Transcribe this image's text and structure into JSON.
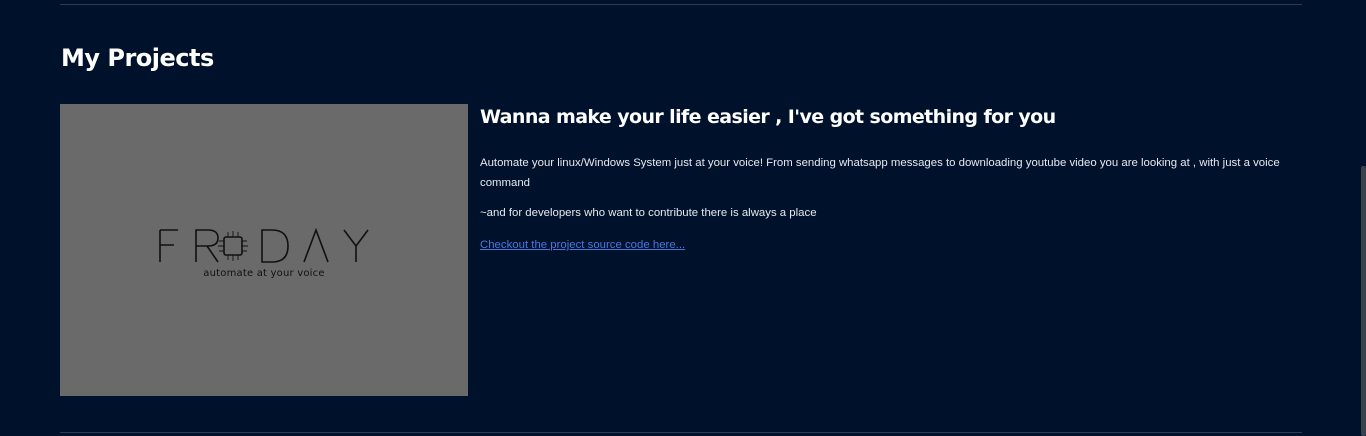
{
  "section": {
    "title": "My Projects"
  },
  "project": {
    "image": {
      "logo_text": "FR DAY",
      "tagline": "automate at your voice"
    },
    "title": "Wanna make your life easier , I've got something for you",
    "description": "Automate your linux/Windows System just at your voice! From sending whatsapp messages to downloading youtube video you are looking at , with just a voice command",
    "note": "~and for developers who want to contribute there is always a place",
    "link_label": "Checkout the project source code here..."
  },
  "colors": {
    "background": "#00112b",
    "divider": "#2c3a55",
    "image_bg": "#6b6a6a",
    "link": "#4a78e0",
    "scrollbar": "#3a4148"
  }
}
